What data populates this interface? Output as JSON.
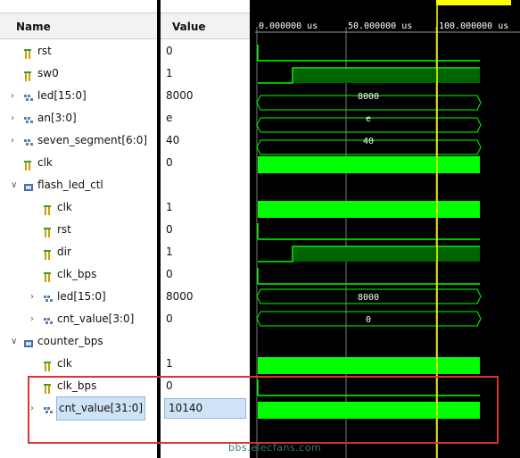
{
  "headers": {
    "name": "Name",
    "value": "Value"
  },
  "signals": [
    {
      "name": "rst",
      "value": "0",
      "type": "bit",
      "expandable": false
    },
    {
      "name": "sw0",
      "value": "1",
      "type": "bit",
      "expandable": false
    },
    {
      "name": "led[15:0]",
      "value": "8000",
      "type": "bus",
      "expandable": true
    },
    {
      "name": "an[3:0]",
      "value": "e",
      "type": "bus",
      "expandable": true
    },
    {
      "name": "seven_segment[6:0]",
      "value": "40",
      "type": "bus",
      "expandable": true
    },
    {
      "name": "clk",
      "value": "0",
      "type": "bit",
      "expandable": false
    },
    {
      "name": "flash_led_ctl",
      "value": "",
      "type": "group",
      "expandable": true
    },
    {
      "name": "clk",
      "value": "1",
      "type": "bit",
      "expandable": false
    },
    {
      "name": "rst",
      "value": "0",
      "type": "bit",
      "expandable": false
    },
    {
      "name": "dir",
      "value": "1",
      "type": "bit",
      "expandable": false
    },
    {
      "name": "clk_bps",
      "value": "0",
      "type": "bit",
      "expandable": false
    },
    {
      "name": "led[15:0]",
      "value": "8000",
      "type": "bus",
      "expandable": true
    },
    {
      "name": "cnt_value[3:0]",
      "value": "0",
      "type": "bus",
      "expandable": true
    },
    {
      "name": "counter_bps",
      "value": "",
      "type": "group",
      "expandable": true
    },
    {
      "name": "clk",
      "value": "1",
      "type": "bit",
      "expandable": false
    },
    {
      "name": "clk_bps",
      "value": "0",
      "type": "bit",
      "expandable": false
    },
    {
      "name": "cnt_value[31:0]",
      "value": "10140",
      "type": "bus",
      "expandable": true,
      "selected": true
    }
  ],
  "timeline": {
    "ticks": [
      "0.000000 us",
      "50.000000 us",
      "100.000000 us"
    ],
    "cursor_label": ""
  },
  "bus_labels": {
    "led": "8000",
    "an": "e",
    "seven_segment": "40",
    "flash_led": "8000",
    "cnt_value_4": "0"
  },
  "watermark": "bbs.elecfans.com",
  "colors": {
    "wave_bg": "#000000",
    "wave_green": "#00ff00",
    "wave_dark_green": "#006400",
    "cursor": "#ffff00",
    "highlight_box": "#e03030"
  }
}
